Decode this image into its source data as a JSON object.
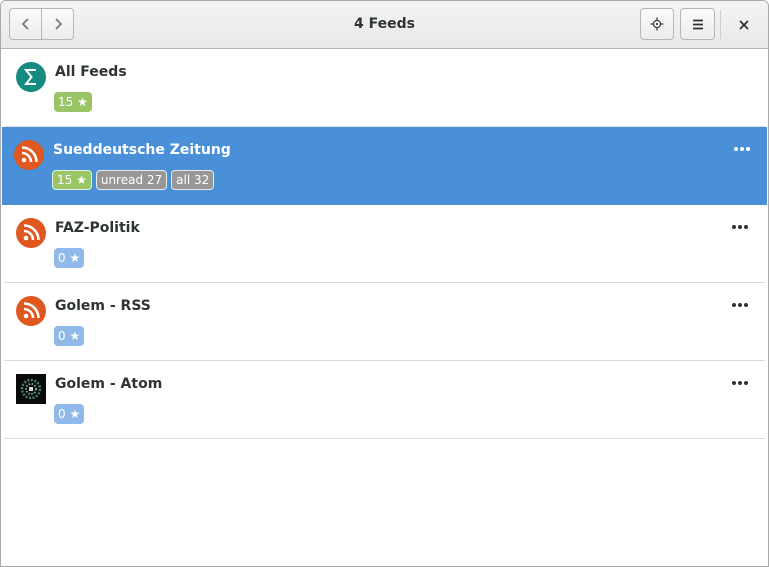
{
  "window": {
    "title": "4 Feeds"
  },
  "headerbar": {
    "back_icon": "chevron-left-icon",
    "forward_icon": "chevron-right-icon",
    "crosshair_icon": "crosshair-icon",
    "menu_icon": "hamburger-menu-icon",
    "close_icon": "close-icon"
  },
  "feeds": [
    {
      "title": "All Feeds",
      "icon": "sigma-icon",
      "starred": "15 ★",
      "unread": "",
      "all": ""
    },
    {
      "title": "Sueddeutsche Zeitung",
      "icon": "rss-icon",
      "starred": "15 ★",
      "unread": "unread 27",
      "all": "all 32",
      "selected": true
    },
    {
      "title": "FAZ-Politik",
      "icon": "rss-icon",
      "starred": "0 ★",
      "unread": "",
      "all": ""
    },
    {
      "title": "Golem - RSS",
      "icon": "rss-icon",
      "starred": "0 ★",
      "unread": "",
      "all": ""
    },
    {
      "title": "Golem - Atom",
      "icon": "golem-logo-icon",
      "starred": "0 ★",
      "unread": "",
      "all": ""
    }
  ],
  "colors": {
    "selection": "#4a90d9",
    "badge_green": "#9ac566",
    "badge_blue": "#90b8e8",
    "badge_gray": "#979795",
    "rss_orange": "#e0571f",
    "sigma_teal": "#148a80"
  }
}
